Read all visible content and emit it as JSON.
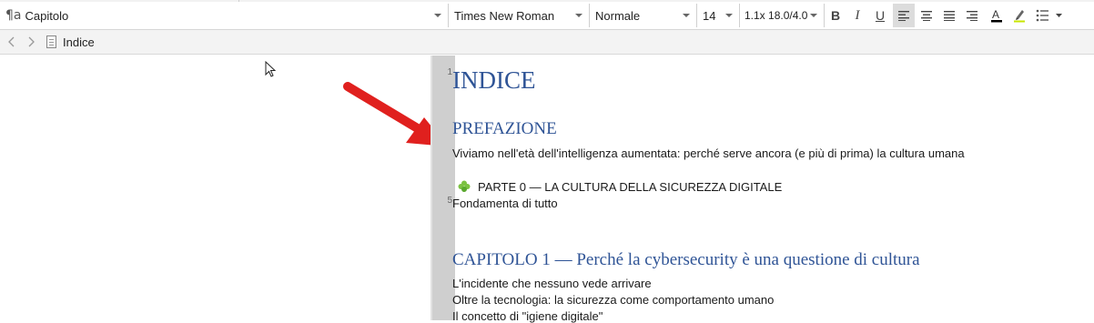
{
  "toolbar": {
    "style_combo": {
      "icon": "paragraph-style-icon",
      "value": "Capitolo"
    },
    "font_combo": {
      "value": "Times New Roman"
    },
    "para_combo": {
      "value": "Normale"
    },
    "size_combo": {
      "value": "14"
    },
    "spacing_combo": {
      "value": "1.1x 18.0/4.0"
    },
    "bold_label": "B",
    "italic_label": "I",
    "underline_label": "U",
    "active_align": "align-left",
    "highlight_color": "#c8e600",
    "font_color": "#000000"
  },
  "navbar": {
    "breadcrumb": "Indice"
  },
  "ruler": {
    "numbers": [
      "1",
      "5"
    ]
  },
  "document": {
    "heading1": "INDICE",
    "preface_heading": "PREFAZIONE",
    "preface_line": "Viviamo nell'età dell'intelligenza aumentata: perché serve ancora (e più di prima) la cultura umana",
    "part0_prefix": "",
    "part0_line": "PARTE 0 — LA CULTURA DELLA SICUREZZA DIGITALE",
    "part0_sub": "Fondamenta di tutto",
    "chapter1_heading": "CAPITOLO 1 — Perché la cybersecurity è una questione di cultura",
    "ch1_items": [
      "L'incidente che nessuno vede arrivare",
      "Oltre la tecnologia: la sicurezza come comportamento umano",
      "Il concetto di \"igiene digitale\""
    ]
  },
  "colors": {
    "heading": "#2f5496",
    "arrow": "#e0201e",
    "spellcheck": "#e03030"
  }
}
